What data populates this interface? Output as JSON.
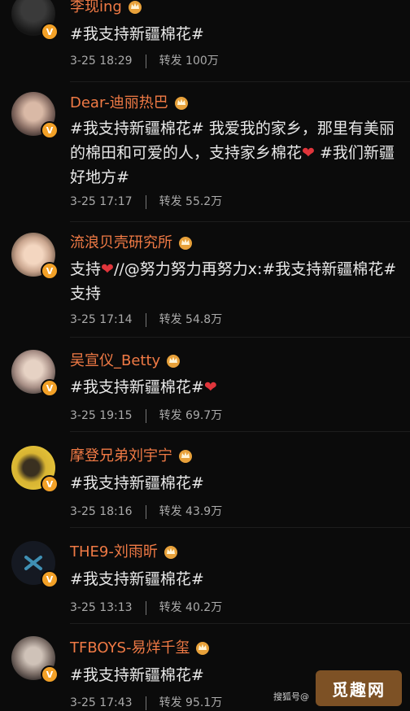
{
  "comments": [
    {
      "avatar_icon": "avatar-man-dark",
      "name": "李现ing",
      "text": "#我支持新疆棉花#",
      "time": "3-25 18:29",
      "repost_label": "转发",
      "reposts": "100万"
    },
    {
      "avatar_icon": "avatar-woman",
      "name": "Dear-迪丽热巴",
      "text_parts": [
        "#我支持新疆棉花# 我爱我的家乡，那里有美丽的棉田和可爱的人，支持家乡棉花",
        "❤",
        " #我们新疆好地方#"
      ],
      "time": "3-25 17:17",
      "repost_label": "转发",
      "reposts": "55.2万"
    },
    {
      "avatar_icon": "avatar-cartoon",
      "name": "流浪贝壳研究所",
      "text_parts": [
        "支持",
        "❤",
        "//@努力努力再努力x:#我支持新疆棉花# 支持"
      ],
      "time": "3-25 17:14",
      "repost_label": "转发",
      "reposts": "54.8万"
    },
    {
      "avatar_icon": "avatar-woman-2",
      "name": "吴宣仪_Betty",
      "text_parts": [
        "#我支持新疆棉花#",
        "❤",
        ""
      ],
      "time": "3-25 19:15",
      "repost_label": "转发",
      "reposts": "69.7万"
    },
    {
      "avatar_icon": "avatar-man-yellow",
      "name": "摩登兄弟刘宇宁",
      "text": "#我支持新疆棉花#",
      "time": "3-25 18:16",
      "repost_label": "转发",
      "reposts": "43.9万"
    },
    {
      "avatar_icon": "avatar-logo-dark",
      "name": "THE9-刘雨昕",
      "text": "#我支持新疆棉花#",
      "time": "3-25 13:13",
      "repost_label": "转发",
      "reposts": "40.2万"
    },
    {
      "avatar_icon": "avatar-boy",
      "name": "TFBOYS-易烊千玺",
      "text": "#我支持新疆棉花#",
      "time": "3-25 17:43",
      "repost_label": "转发",
      "reposts": "95.1万"
    }
  ],
  "watermark": {
    "source": "搜狐号@",
    "logo": "觅趣网"
  },
  "colors": {
    "name": "#f07a45",
    "verified_badge": "#f3a127",
    "crown": "#e8a13a",
    "heart": "#e0353b",
    "background": "#0b0b0b"
  }
}
